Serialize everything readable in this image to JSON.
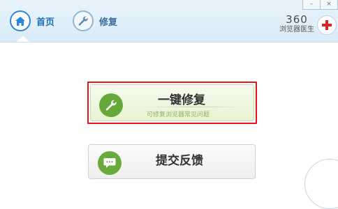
{
  "header": {
    "nav": [
      {
        "label": "首页",
        "icon": "home-icon",
        "active": true
      },
      {
        "label": "修复",
        "icon": "wrench-icon",
        "active": false
      }
    ],
    "window_controls": {
      "minimize": "–",
      "close": "×"
    },
    "brand": {
      "number": "360",
      "name": "浏览器医生",
      "icon": "red-cross-icon"
    }
  },
  "main": {
    "repair_button": {
      "title": "一键修复",
      "subtitle": "可修复浏览器常见问题",
      "icon": "wrench-icon"
    },
    "feedback_button": {
      "title": "提交反馈",
      "icon": "chat-bubble-icon"
    }
  },
  "colors": {
    "accent_blue": "#2e86d6",
    "green": "#67a83a",
    "highlight_red": "#e4141b",
    "cross_red": "#d9261c"
  }
}
